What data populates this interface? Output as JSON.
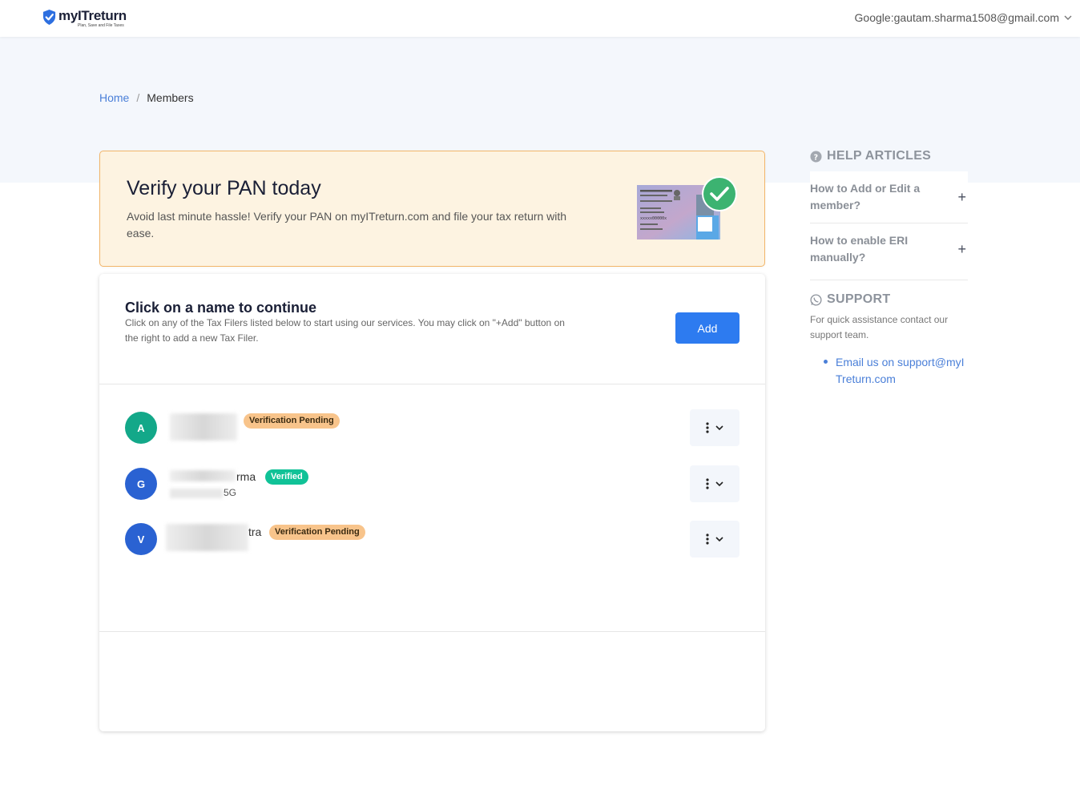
{
  "header": {
    "brand": "myITreturn",
    "tagline": "Plan, Save and File Taxes",
    "account": "Google:gautam.sharma1508@gmail.com"
  },
  "breadcrumb": {
    "home": "Home",
    "separator": "/",
    "current": "Members"
  },
  "pan_banner": {
    "title": "Verify your PAN today",
    "description": "Avoid last minute hassle! Verify your PAN on myITreturn.com and file your tax return with ease."
  },
  "members": {
    "title": "Click on a name to continue",
    "description": "Click on any of the Tax Filers listed below to start using our services. You may click on \"+Add\" button on the right to add a new Tax Filer.",
    "add_label": "Add",
    "list": [
      {
        "initial": "A",
        "name_visible": "",
        "sub_visible": "",
        "status": "Verification Pending",
        "avatar_color": "#13a889"
      },
      {
        "initial": "G",
        "name_visible": "rma",
        "sub_visible": "5G",
        "status": "Verified",
        "avatar_color": "#2a62d2"
      },
      {
        "initial": "V",
        "name_visible": "tra",
        "sub_visible": "",
        "status": "Verification Pending",
        "avatar_color": "#2a62d2"
      }
    ]
  },
  "sidebar": {
    "help_heading": "HELP ARTICLES",
    "articles": [
      "How to Add or Edit a member?",
      "How to enable ERI manually?"
    ],
    "support_heading": "SUPPORT",
    "support_text": "For quick assistance contact our support team.",
    "email_link": "Email us on support@myITreturn.com"
  },
  "colors": {
    "accent": "#2d7bf0",
    "banner_bg": "#fdf3e1",
    "banner_border": "#f2b569",
    "pending": "#f8c48b",
    "verified": "#10c297"
  },
  "icons": [
    "shield-check-icon",
    "chevron-down-icon",
    "question-circle-icon",
    "plus-icon",
    "whatsapp-icon",
    "kebab-menu-icon",
    "pan-card-check-illustration"
  ]
}
